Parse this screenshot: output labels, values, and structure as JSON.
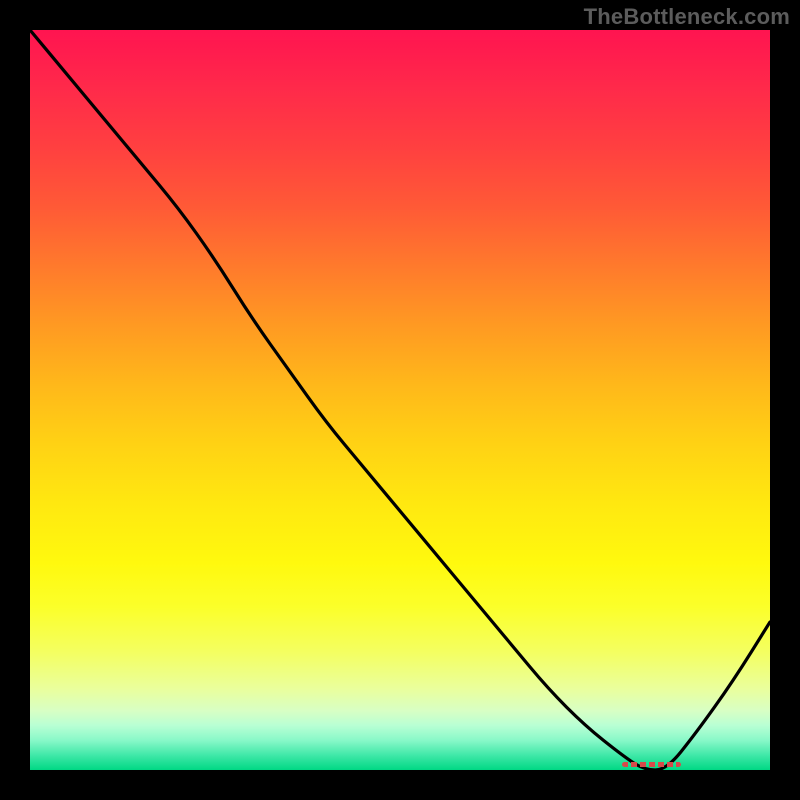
{
  "watermark": "TheBottleneck.com",
  "chart_data": {
    "type": "line",
    "title": "",
    "xlabel": "",
    "ylabel": "",
    "xlim": [
      0,
      100
    ],
    "ylim": [
      0,
      100
    ],
    "grid": false,
    "legend": false,
    "background_gradient": {
      "direction": "vertical",
      "stops": [
        {
          "pos": 0.0,
          "color": "#ff1450"
        },
        {
          "pos": 0.5,
          "color": "#ffc818"
        },
        {
          "pos": 0.8,
          "color": "#fbff2a"
        },
        {
          "pos": 1.0,
          "color": "#00d884"
        }
      ]
    },
    "series": [
      {
        "name": "bottleneck-curve",
        "x": [
          0,
          5,
          10,
          15,
          20,
          25,
          30,
          35,
          40,
          45,
          50,
          55,
          60,
          65,
          70,
          75,
          80,
          83,
          86,
          90,
          95,
          100
        ],
        "y": [
          100,
          94,
          88,
          82,
          76,
          69,
          61,
          54,
          47,
          41,
          35,
          29,
          23,
          17,
          11,
          6,
          2,
          0,
          0,
          5,
          12,
          20
        ]
      }
    ],
    "annotations": [
      {
        "name": "min-marker",
        "kind": "dashed-segment",
        "x_range": [
          80,
          88
        ],
        "y": 0.8,
        "color": "#d64a4a"
      }
    ]
  }
}
